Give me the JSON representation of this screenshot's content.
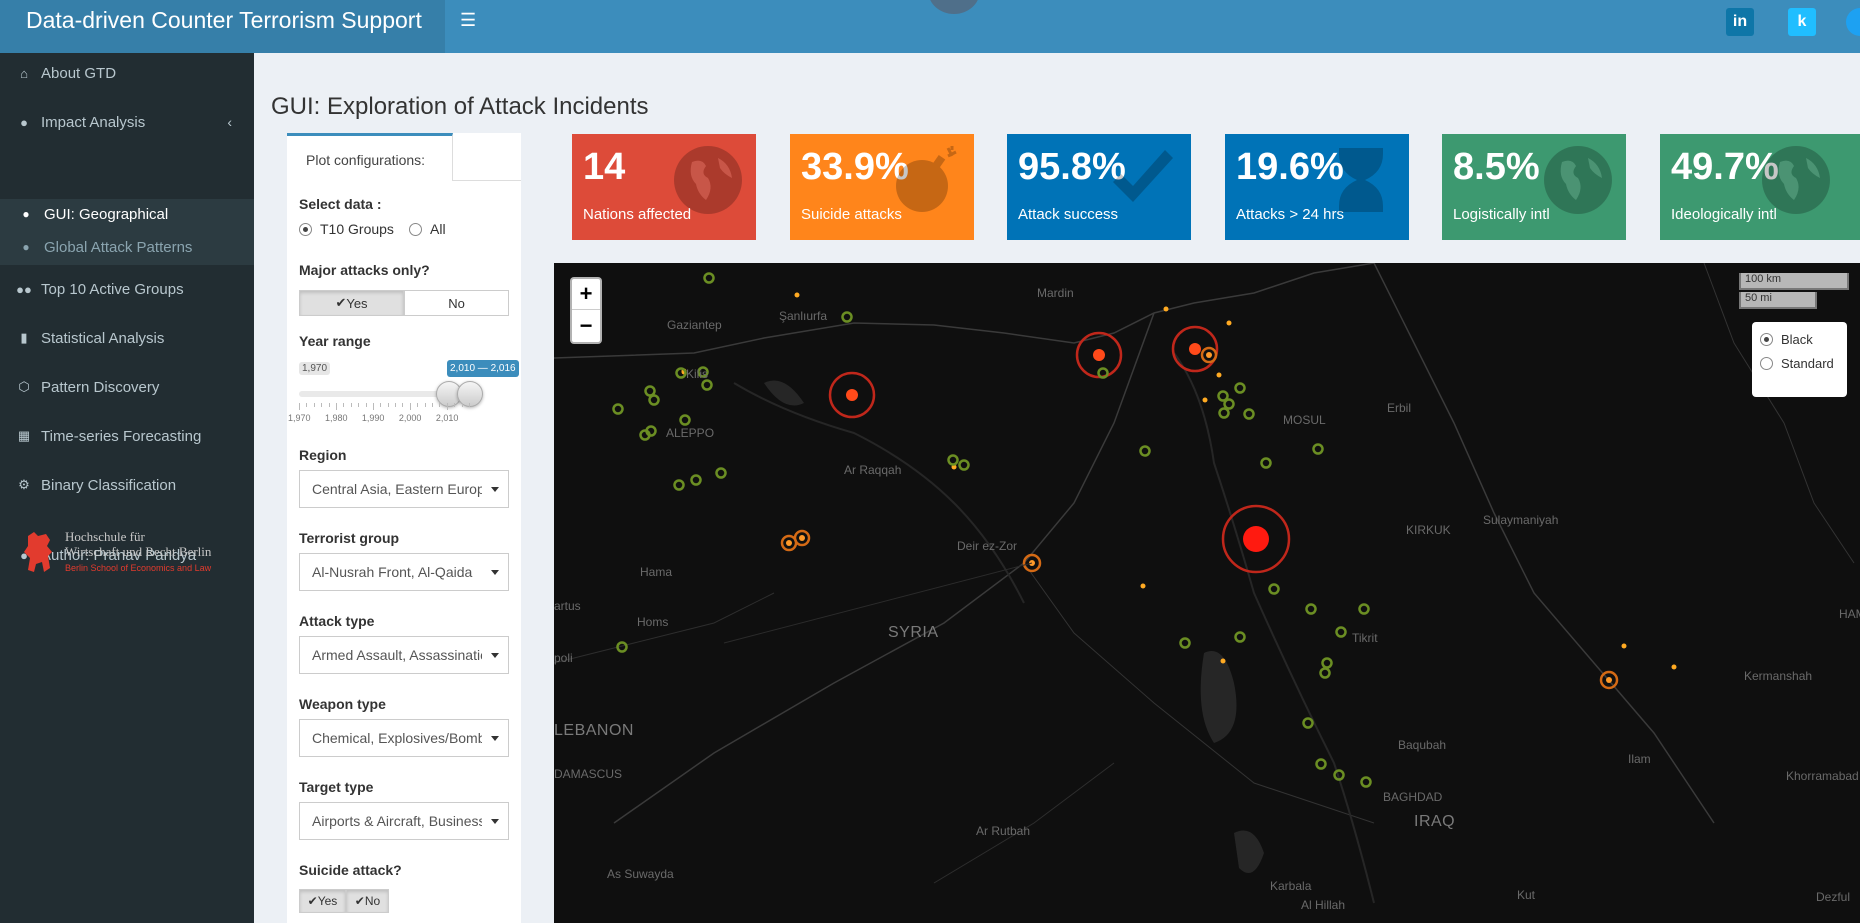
{
  "header": {
    "title": "Data-driven Counter Terrorism Support",
    "menu_icon": "hamburger-icon",
    "social": [
      {
        "name": "linkedin",
        "label": "in",
        "color": "#0e76a8"
      },
      {
        "name": "kaggle",
        "label": "k",
        "color": "#20beff"
      },
      {
        "name": "twitter",
        "label": "t",
        "color": "#1da1f2"
      }
    ]
  },
  "sidebar": {
    "items": [
      {
        "label": "About GTD",
        "icon": "home-icon"
      },
      {
        "label": "Impact Analysis",
        "icon": "globe-icon"
      },
      {
        "label": "Top 10 Active Groups",
        "icon": "users-icon"
      },
      {
        "label": "Statistical Analysis",
        "icon": "bar-chart-icon"
      },
      {
        "label": "Pattern Discovery",
        "icon": "cube-icon"
      },
      {
        "label": "Time-series Forecasting",
        "icon": "calendar-icon"
      },
      {
        "label": "Binary Classification",
        "icon": "cogs-icon"
      },
      {
        "label": "Author: Pranav Pandya",
        "icon": "user-icon"
      }
    ],
    "submenu": [
      {
        "label": "GUI: Geographical",
        "icon": "globe-icon"
      },
      {
        "label": "Global Attack Patterns",
        "icon": "globe-icon"
      }
    ],
    "logo_text": {
      "line1": "Hochschule für",
      "line2": "Wirtschaft und Recht Berlin",
      "line3": "Berlin School of Economics and Law"
    }
  },
  "page": {
    "title": "GUI: Exploration of Attack Incidents"
  },
  "config": {
    "tab_label": "Plot configurations:",
    "select_data": {
      "label": "Select data :",
      "options": [
        "T10 Groups",
        "All"
      ],
      "selected": "T10 Groups"
    },
    "major_attacks": {
      "label": "Major attacks only?",
      "yes": "Yes",
      "no": "No",
      "selected": "Yes"
    },
    "year_range": {
      "label": "Year range",
      "min_label": "1,970",
      "range_label": "2,010 — 2,016",
      "ticks": [
        "1,970",
        "1,980",
        "1,990",
        "2,000",
        "2,010"
      ],
      "min": 1970,
      "max": 2016,
      "from": 2010,
      "to": 2016
    },
    "region": {
      "label": "Region",
      "value": "Central Asia, Eastern Europe"
    },
    "group": {
      "label": "Terrorist group",
      "value": "Al-Nusrah Front, Al-Qaida"
    },
    "attack_type": {
      "label": "Attack type",
      "value": "Armed Assault, Assassination"
    },
    "weapon_type": {
      "label": "Weapon type",
      "value": "Chemical, Explosives/Bombs"
    },
    "target_type": {
      "label": "Target type",
      "value": "Airports & Aircraft, Business"
    },
    "suicide": {
      "label": "Suicide attack?",
      "yes": "Yes",
      "no": "No",
      "selected": [
        "Yes",
        "No"
      ]
    }
  },
  "value_boxes": [
    {
      "value": "14",
      "label": "Nations affected",
      "color": "#dd4b39",
      "icon": "globe-icon"
    },
    {
      "value": "33.9%",
      "label": "Suicide attacks",
      "color": "#ff851b",
      "icon": "bomb-icon"
    },
    {
      "value": "95.8%",
      "label": "Attack success",
      "color": "#0073b7",
      "icon": "check-icon"
    },
    {
      "value": "19.6%",
      "label": "Attacks > 24 hrs",
      "color": "#0073b7",
      "icon": "hourglass-icon"
    },
    {
      "value": "8.5%",
      "label": "Logistically intl",
      "color": "#3d9970",
      "icon": "globe-icon"
    },
    {
      "value": "49.7%",
      "label": "Ideologically intl",
      "color": "#3d9970",
      "icon": "globe-icon"
    }
  ],
  "map": {
    "zoom_in": "+",
    "zoom_out": "−",
    "scale_km": "100 km",
    "scale_mi": "50 mi",
    "basemap_options": [
      "Black",
      "Standard"
    ],
    "basemap_selected": "Black",
    "place_labels": [
      "Mardin",
      "Şanlıurfa",
      "Gaziantep",
      "Kilis",
      "ALEPPO",
      "Ar Raqqah",
      "Deir ez-Zor",
      "Hama",
      "Homs",
      "SYRIA",
      "MOSUL",
      "Erbil",
      "KIRKUK",
      "Sulaymaniyah",
      "Tikrit",
      "HAMED",
      "Kermanshah",
      "Baqubah",
      "Ilam",
      "Khorramabad",
      "BAGHDAD",
      "IRAQ",
      "Ar Rutbah",
      "As Suwayda",
      "DAMASCUS",
      "LEBANON",
      "Karbala",
      "Al Hillah",
      "Kut",
      "Dezful",
      "artus",
      "poli"
    ]
  }
}
